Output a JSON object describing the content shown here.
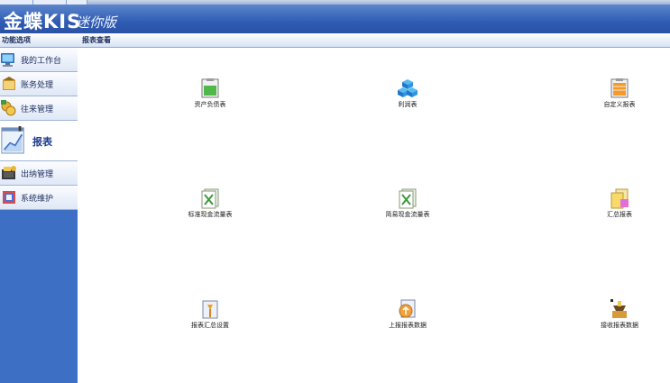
{
  "window": {
    "brand_main": "金蝶KIS",
    "brand_sub": "迷你版"
  },
  "sidebar": {
    "header": "功能选项",
    "items": [
      {
        "label": "我的工作台",
        "icon": "monitor-icon"
      },
      {
        "label": "账务处理",
        "icon": "ledger-icon"
      },
      {
        "label": "往来管理",
        "icon": "coins-icon"
      },
      {
        "label": "报表",
        "icon": "report-chart-icon",
        "active": true
      },
      {
        "label": "出纳管理",
        "icon": "cashier-icon"
      },
      {
        "label": "系统维护",
        "icon": "system-maintenance-icon"
      }
    ]
  },
  "main": {
    "header": "报表查看",
    "reports": [
      {
        "label": "资产负债表",
        "icon": "balance-sheet-icon"
      },
      {
        "label": "利润表",
        "icon": "profit-cubes-icon"
      },
      {
        "label": "自定义报表",
        "icon": "custom-report-icon"
      },
      {
        "label": "标准现金流量表",
        "icon": "standard-cashflow-icon"
      },
      {
        "label": "简易现金流量表",
        "icon": "simple-cashflow-icon"
      },
      {
        "label": "汇总报表",
        "icon": "summary-report-icon"
      },
      {
        "label": "报表汇总设置",
        "icon": "report-summary-settings-icon"
      },
      {
        "label": "上报报表数据",
        "icon": "upload-report-icon"
      },
      {
        "label": "接收报表数据",
        "icon": "receive-report-icon"
      }
    ]
  }
}
